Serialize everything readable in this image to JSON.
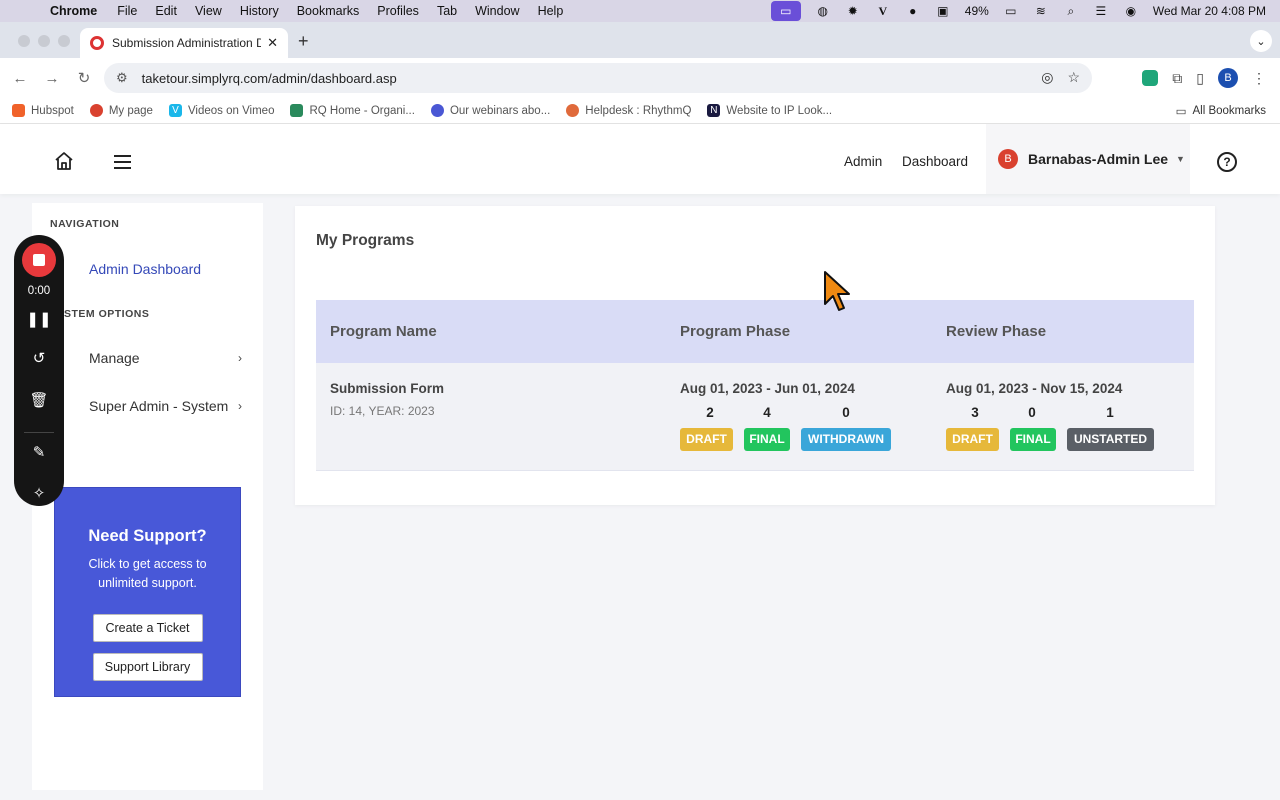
{
  "mac_menu": {
    "app": "Chrome",
    "items": [
      "File",
      "Edit",
      "View",
      "History",
      "Bookmarks",
      "Profiles",
      "Tab",
      "Window",
      "Help"
    ],
    "battery": "49%",
    "datetime": "Wed Mar 20  4:08 PM"
  },
  "browser": {
    "tab_title": "Submission Administration Da",
    "url": "taketour.simplyrq.com/admin/dashboard.asp",
    "profile_initial": "B",
    "bookmarks": [
      {
        "label": "Hubspot",
        "color": "#f0622a"
      },
      {
        "label": "My page",
        "color": "#d9412f"
      },
      {
        "label": "Videos on Vimeo",
        "color": "#1ab7ea"
      },
      {
        "label": "RQ Home - Organi...",
        "color": "#2a8a5c"
      },
      {
        "label": "Our webinars abo...",
        "color": "#4a57d4"
      },
      {
        "label": "Helpdesk : RhythmQ",
        "color": "#e06a3b"
      },
      {
        "label": "Website to IP Look...",
        "color": "#1a1a40"
      }
    ],
    "all_bookmarks": "All Bookmarks"
  },
  "header": {
    "links": [
      "Admin",
      "Dashboard"
    ],
    "user_initial": "B",
    "user_name": "Barnabas-Admin Lee"
  },
  "sidebar": {
    "nav_heading": "NAVIGATION",
    "items": [
      {
        "label": "Admin Dashboard"
      }
    ],
    "options_heading": "STEM OPTIONS",
    "options": [
      {
        "label": "Manage"
      },
      {
        "label": "Super Admin - System"
      }
    ]
  },
  "support": {
    "title": "Need Support?",
    "text": "Click to get access to unlimited support.",
    "ticket_button": "Create a Ticket",
    "library_button": "Support Library"
  },
  "recorder": {
    "time": "0:00"
  },
  "programs": {
    "title": "My Programs",
    "columns": [
      "Program Name",
      "Program Phase",
      "Review Phase"
    ],
    "rows": [
      {
        "name": "Submission Form",
        "meta": "ID: 14, YEAR: 2023",
        "program_phase": {
          "dates": "Aug 01, 2023 - Jun 01, 2024",
          "counts": [
            "2",
            "4",
            "0"
          ],
          "badges": [
            {
              "label": "DRAFT",
              "color": "#e6b83a"
            },
            {
              "label": "FINAL",
              "color": "#22c55e"
            },
            {
              "label": "WITHDRAWN",
              "color": "#3aa6d9"
            }
          ]
        },
        "review_phase": {
          "dates": "Aug 01, 2023 - Nov 15, 2024",
          "counts": [
            "3",
            "0",
            "1"
          ],
          "badges": [
            {
              "label": "DRAFT",
              "color": "#e6b83a"
            },
            {
              "label": "FINAL",
              "color": "#22c55e"
            },
            {
              "label": "UNSTARTED",
              "color": "#5a5f66"
            }
          ]
        }
      }
    ]
  }
}
